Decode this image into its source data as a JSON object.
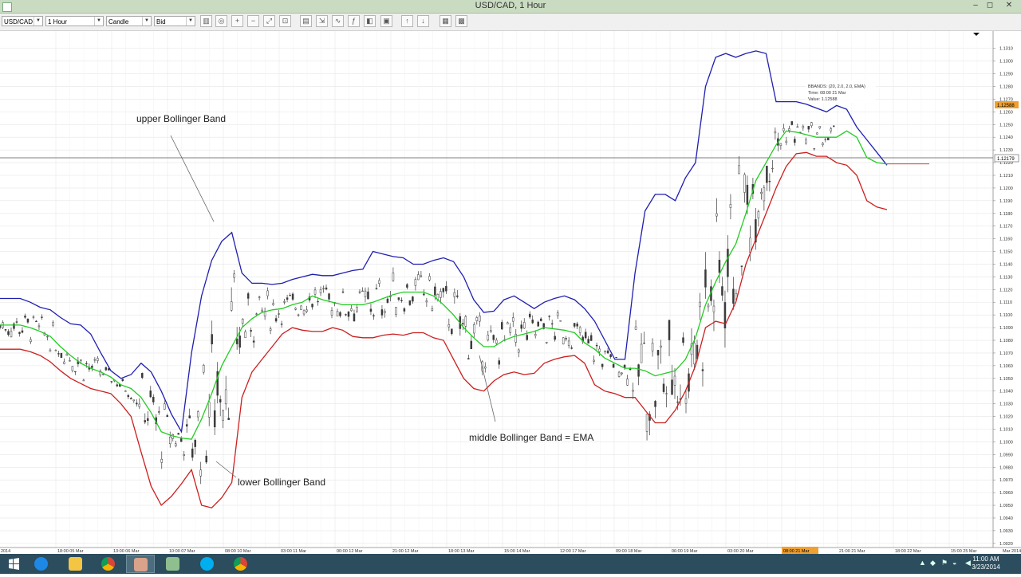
{
  "window": {
    "title": "USD/CAD,  1 Hour",
    "controls": {
      "minimize": "–",
      "restore": "◻",
      "close": "✕"
    }
  },
  "toolbar": {
    "instrument": "USD/CAD",
    "timeframe": "1 Hour",
    "chart_type": "Candle",
    "price_side": "Bid",
    "buttons": [
      "chart-type",
      "zoom-in",
      "zoom-out",
      "zoom-fit",
      "zoom-reset",
      "indicator",
      "drawing",
      "period",
      "fx",
      "tools",
      "template",
      "buy",
      "sell",
      "screenshot",
      "print",
      "export"
    ]
  },
  "chart_data": {
    "type": "line",
    "y_ticks": [
      "1.1310",
      "1.1300",
      "1.1290",
      "1.1280",
      "1.1270",
      "1.1260",
      "1.1250",
      "1.1240",
      "1.1230",
      "1.1220",
      "1.1210",
      "1.1200",
      "1.1190",
      "1.1180",
      "1.1170",
      "1.1160",
      "1.1150",
      "1.1140",
      "1.1130",
      "1.1120",
      "1.1110",
      "1.1100",
      "1.1090",
      "1.1080",
      "1.1070",
      "1.1060",
      "1.1050",
      "1.1040",
      "1.1030",
      "1.1020",
      "1.1010",
      "1.1000",
      "1.0990",
      "1.0980",
      "1.0970",
      "1.0960",
      "1.0950",
      "1.0940",
      "1.0930",
      "1.0920"
    ],
    "ylim": [
      1.0918,
      1.1318
    ],
    "x_ticks": [
      "2014",
      "18:00 05 Mar",
      "13:00 06 Mar",
      "10:00 07 Mar",
      "08:00 10 Mar",
      "03:00 11 Mar",
      "00:00 12 Mar",
      "21:00 12 Mar",
      "18:00 13 Mar",
      "15:00 14 Mar",
      "12:00 17 Mar",
      "09:00 18 Mar",
      "06:00 19 Mar",
      "03:00 20 Mar",
      "00:00 21 Mar",
      "21:00 21 Mar",
      "18:00 22 Mar",
      "15:00 25 Mar",
      "Mar 2014"
    ],
    "x_highlight": "08:00 21 Mar",
    "current_price": "1.12179",
    "cursor_price": "1.12588",
    "tooltip": [
      "BBANDS: (20, 2.0, 2.0, EMA)",
      "Time: 08:00 21 Mar",
      "Value: 1.12588"
    ],
    "series": [
      {
        "name": "upper Bollinger Band",
        "color": "#1f1fb0",
        "values": [
          1.1113,
          1.1113,
          1.1113,
          1.111,
          1.1106,
          1.1104,
          1.1098,
          1.1093,
          1.1092,
          1.1085,
          1.107,
          1.1056,
          1.105,
          1.1053,
          1.1062,
          1.1055,
          1.104,
          1.1022,
          1.1008,
          1.107,
          1.1115,
          1.1143,
          1.1158,
          1.1165,
          1.1133,
          1.1125,
          1.1125,
          1.1124,
          1.1125,
          1.1128,
          1.113,
          1.1132,
          1.1131,
          1.1131,
          1.1133,
          1.1135,
          1.1136,
          1.115,
          1.1148,
          1.1146,
          1.1145,
          1.114,
          1.114,
          1.1143,
          1.1145,
          1.1142,
          1.113,
          1.1112,
          1.1102,
          1.1103,
          1.1112,
          1.1115,
          1.111,
          1.1105,
          1.111,
          1.1113,
          1.1115,
          1.1112,
          1.1105,
          1.1095,
          1.108,
          1.1065,
          1.1065,
          1.1133,
          1.1182,
          1.1195,
          1.1195,
          1.119,
          1.1208,
          1.122,
          1.128,
          1.1303,
          1.1306,
          1.1303,
          1.1306,
          1.1308,
          1.1306,
          1.1268,
          1.1268,
          1.1268,
          1.1266,
          1.1263,
          1.126,
          1.1265,
          1.1262,
          1.1248,
          1.1238,
          1.1228,
          1.1218
        ]
      },
      {
        "name": "middle Bollinger Band = EMA",
        "color": "#22cc22",
        "values": [
          1.1092,
          1.1092,
          1.1092,
          1.109,
          1.1087,
          1.1083,
          1.1075,
          1.1068,
          1.1062,
          1.1058,
          1.1055,
          1.1051,
          1.1045,
          1.1042,
          1.1035,
          1.1023,
          1.1008,
          1.1005,
          1.1003,
          1.1002,
          1.1018,
          1.1038,
          1.106,
          1.1075,
          1.109,
          1.1097,
          1.1102,
          1.1104,
          1.1105,
          1.1108,
          1.111,
          1.1115,
          1.1112,
          1.111,
          1.1108,
          1.1108,
          1.1108,
          1.111,
          1.1113,
          1.1116,
          1.1118,
          1.1118,
          1.1118,
          1.1115,
          1.1108,
          1.11,
          1.109,
          1.1082,
          1.1075,
          1.1075,
          1.108,
          1.1083,
          1.1085,
          1.1087,
          1.109,
          1.1089,
          1.1088,
          1.1086,
          1.1078,
          1.1073,
          1.1066,
          1.1062,
          1.1058,
          1.1058,
          1.1056,
          1.1052,
          1.1054,
          1.1056,
          1.1065,
          1.1082,
          1.1108,
          1.1126,
          1.1142,
          1.1156,
          1.118,
          1.1206,
          1.122,
          1.1234,
          1.1245,
          1.1244,
          1.1242,
          1.124,
          1.124,
          1.124,
          1.1245,
          1.124,
          1.1224,
          1.122,
          1.1219
        ]
      },
      {
        "name": "lower Bollinger Band",
        "color": "#cc1f1f",
        "values": [
          1.1073,
          1.1073,
          1.1073,
          1.1071,
          1.1068,
          1.1063,
          1.1056,
          1.105,
          1.1046,
          1.1042,
          1.104,
          1.1038,
          1.103,
          1.102,
          1.0992,
          1.0965,
          1.095,
          1.0957,
          1.0967,
          1.0978,
          1.095,
          1.0948,
          1.0956,
          1.0968,
          1.1035,
          1.1055,
          1.1065,
          1.1075,
          1.1085,
          1.109,
          1.1088,
          1.1087,
          1.1087,
          1.109,
          1.1088,
          1.1083,
          1.1082,
          1.1082,
          1.1084,
          1.1085,
          1.1084,
          1.1086,
          1.1086,
          1.1082,
          1.108,
          1.1065,
          1.105,
          1.1042,
          1.104,
          1.1048,
          1.1053,
          1.1055,
          1.1053,
          1.1054,
          1.1062,
          1.1065,
          1.1067,
          1.1068,
          1.1062,
          1.1045,
          1.104,
          1.1038,
          1.1035,
          1.1035,
          1.1025,
          1.1015,
          1.1015,
          1.1025,
          1.104,
          1.106,
          1.109,
          1.1095,
          1.1093,
          1.111,
          1.114,
          1.116,
          1.118,
          1.12,
          1.1217,
          1.1227,
          1.1228,
          1.1225,
          1.1225,
          1.122,
          1.1218,
          1.121,
          1.119,
          1.1185,
          1.1183
        ]
      }
    ]
  },
  "annotations": {
    "upper": "upper Bollinger Band",
    "middle": "middle Bollinger Band = EMA",
    "lower": "lower Bollinger Band"
  },
  "taskbar": {
    "apps": [
      "windows-start",
      "internet-explorer",
      "file-explorer",
      "chrome",
      "trading-app",
      "file-manager",
      "skype",
      "chrome-2"
    ],
    "time": "11:00 AM",
    "date": "3/23/2014"
  }
}
